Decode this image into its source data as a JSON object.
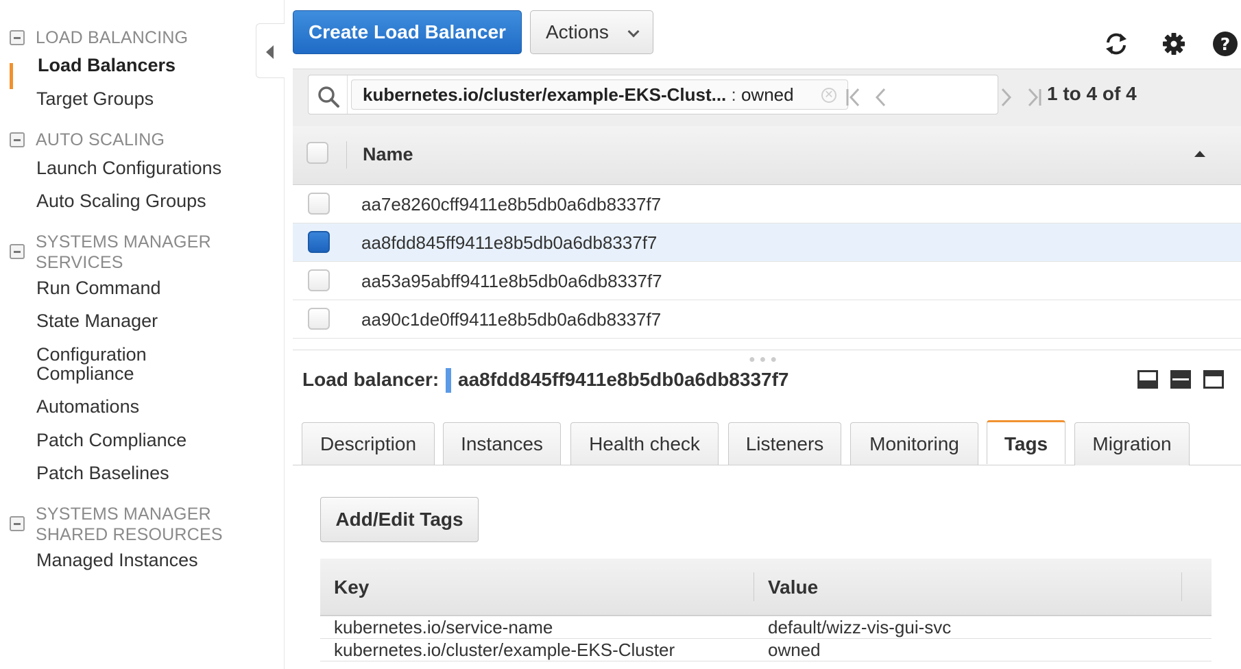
{
  "sidebar": {
    "sections": [
      {
        "title": "LOAD BALANCING",
        "items": [
          "Load Balancers",
          "Target Groups"
        ]
      },
      {
        "title": "AUTO SCALING",
        "items": [
          "Launch Configurations",
          "Auto Scaling Groups"
        ]
      },
      {
        "title_lines": [
          "SYSTEMS MANAGER",
          "SERVICES"
        ],
        "items": [
          "Run Command",
          "State Manager",
          "Configuration",
          "Compliance",
          "Automations",
          "Patch Compliance",
          "Patch Baselines"
        ]
      },
      {
        "title_lines": [
          "SYSTEMS MANAGER",
          "SHARED RESOURCES"
        ],
        "items": [
          "Managed Instances"
        ]
      }
    ],
    "active_item": "Load Balancers"
  },
  "toolbar": {
    "create_label": "Create Load Balancer",
    "actions_label": "Actions",
    "icons": [
      "refresh-icon",
      "gear-icon",
      "help-icon"
    ]
  },
  "filter": {
    "token_key": "kubernetes.io/cluster/example-EKS-Clust...",
    "token_sep": " : ",
    "token_value": "owned"
  },
  "pagination": {
    "text": "1 to 4 of 4"
  },
  "table": {
    "column_name": "Name",
    "rows": [
      {
        "name": "aa7e8260cff9411e8b5db0a6db8337f7",
        "selected": false
      },
      {
        "name": "aa8fdd845ff9411e8b5db0a6db8337f7",
        "selected": true
      },
      {
        "name": "aa53a95abff9411e8b5db0a6db8337f7",
        "selected": false
      },
      {
        "name": "aa90c1de0ff9411e8b5db0a6db8337f7",
        "selected": false
      }
    ]
  },
  "detail": {
    "label": "Load balancer:",
    "name": "aa8fdd845ff9411e8b5db0a6db8337f7",
    "tabs": [
      "Description",
      "Instances",
      "Health check",
      "Listeners",
      "Monitoring",
      "Tags",
      "Migration"
    ],
    "active_tab": "Tags",
    "add_edit_tags_label": "Add/Edit Tags",
    "tags_columns": [
      "Key",
      "Value"
    ],
    "tags": [
      {
        "key": "kubernetes.io/service-name",
        "value": "default/wizz-vis-gui-svc"
      },
      {
        "key": "kubernetes.io/cluster/example-EKS-Cluster",
        "value": "owned"
      }
    ]
  },
  "colors": {
    "accent_orange": "#f0922f",
    "primary_blue": "#2b78d2",
    "selected_row": "#e8f1fb"
  }
}
